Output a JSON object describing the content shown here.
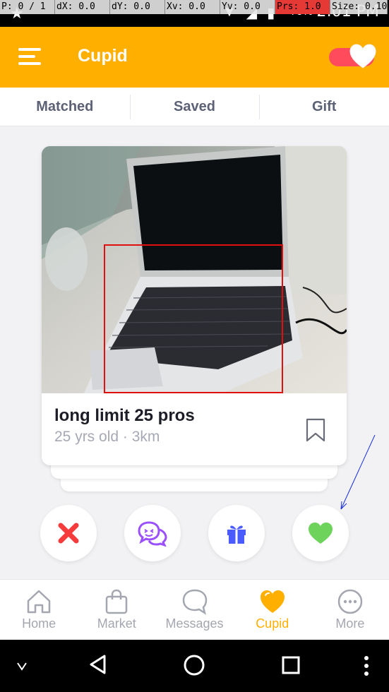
{
  "debug_bar": {
    "p": "P: 0 / 1",
    "dx": "dX: 0.0",
    "dy": "dY: 0.0",
    "xv": "Xv: 0.0",
    "yv": "Yv: 0.0",
    "prs": "Prs: 1.0",
    "size": "Size: 0.10"
  },
  "status_bar": {
    "time": "2:01 PM",
    "battery": "70%"
  },
  "header": {
    "title": "Cupid",
    "toggle_on": true
  },
  "tabs": [
    {
      "label": "Matched"
    },
    {
      "label": "Saved"
    },
    {
      "label": "Gift"
    }
  ],
  "card": {
    "name": "long limit 25 pros",
    "details": "25 yrs old · 3km"
  },
  "actions": [
    {
      "name": "dislike",
      "icon": "x-icon"
    },
    {
      "name": "chat",
      "icon": "chat-bubbles-icon"
    },
    {
      "name": "gift",
      "icon": "gift-icon"
    },
    {
      "name": "like",
      "icon": "heart-icon"
    }
  ],
  "bottom_nav": [
    {
      "label": "Home",
      "icon": "home-icon"
    },
    {
      "label": "Market",
      "icon": "shopping-bag-icon"
    },
    {
      "label": "Messages",
      "icon": "chat-icon"
    },
    {
      "label": "Cupid",
      "icon": "heart-icon",
      "active": true
    },
    {
      "label": "More",
      "icon": "more-dots-icon"
    }
  ],
  "colors": {
    "accent": "#ffaf00",
    "toggle": "#ff4b5c",
    "like_green": "#6dd35b",
    "dislike_red": "#f53b3b",
    "chat_purple": "#9b50ff",
    "gift_blue": "#4a5cff"
  }
}
